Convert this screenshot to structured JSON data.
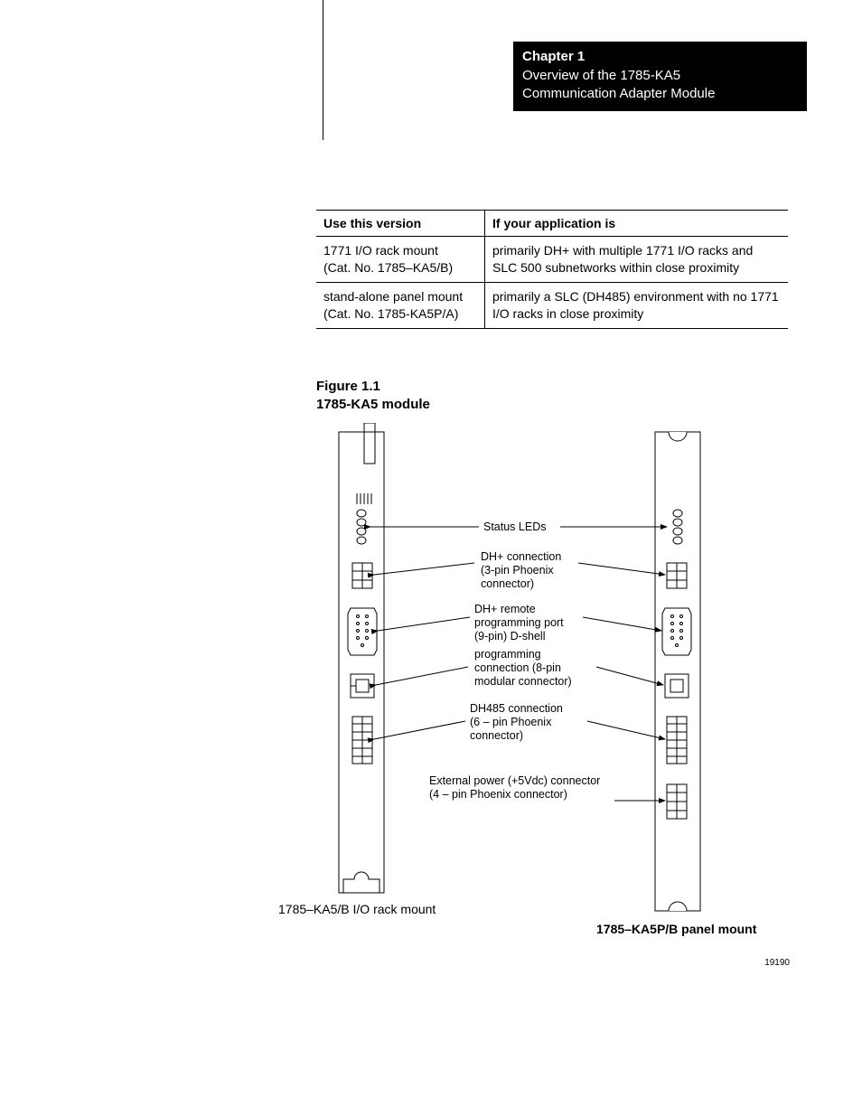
{
  "chapter": {
    "title": "Chapter 1",
    "subtitle1": "Overview of the 1785-KA5",
    "subtitle2": "Communication Adapter Module"
  },
  "table": {
    "head_col1": "Use this version",
    "head_col2": "If your application is",
    "rows": [
      {
        "c1a": "1771 I/O rack mount",
        "c1b": "(Cat. No. 1785–KA5/B)",
        "c2": "primarily DH+ with multiple 1771 I/O racks and SLC 500 subnetworks within close proximity"
      },
      {
        "c1a": "stand-alone panel mount",
        "c1b": "(Cat. No. 1785-KA5P/A)",
        "c2": "primarily a SLC (DH485) environment with no 1771 I/O racks in close proximity"
      }
    ]
  },
  "figure": {
    "number": "Figure 1.1",
    "title": "1785-KA5 module",
    "left_caption": "1785–KA5/B I/O rack mount",
    "right_caption": "1785–KA5P/B panel mount",
    "doc_number": "19190",
    "annotations": {
      "status_leds": "Status LEDs",
      "dh_plus_conn_l1": "DH+ connection",
      "dh_plus_conn_l2": "(3-pin Phoenix",
      "dh_plus_conn_l3": "connector)",
      "dh_plus_remote_l1": "DH+ remote",
      "dh_plus_remote_l2": "programming port",
      "dh_plus_remote_l3": "(9-pin) D-shell",
      "prog_conn_l1": "programming",
      "prog_conn_l2": "connection (8-pin",
      "prog_conn_l3": "modular connector)",
      "dh485_l1": "DH485 connection",
      "dh485_l2": "(6 – pin Phoenix",
      "dh485_l3": "connector)",
      "ext_power_l1": "External power (+5Vdc) connector",
      "ext_power_l2": "(4 – pin Phoenix connector)"
    }
  }
}
